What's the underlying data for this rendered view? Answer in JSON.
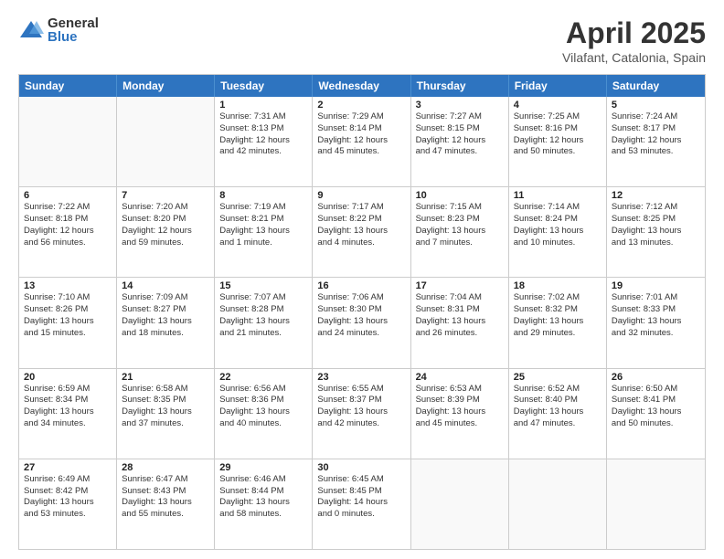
{
  "header": {
    "logo_general": "General",
    "logo_blue": "Blue",
    "title": "April 2025",
    "subtitle": "Vilafant, Catalonia, Spain"
  },
  "days_of_week": [
    "Sunday",
    "Monday",
    "Tuesday",
    "Wednesday",
    "Thursday",
    "Friday",
    "Saturday"
  ],
  "weeks": [
    [
      {
        "day": "",
        "lines": [],
        "empty": true
      },
      {
        "day": "",
        "lines": [],
        "empty": true
      },
      {
        "day": "1",
        "lines": [
          "Sunrise: 7:31 AM",
          "Sunset: 8:13 PM",
          "Daylight: 12 hours",
          "and 42 minutes."
        ]
      },
      {
        "day": "2",
        "lines": [
          "Sunrise: 7:29 AM",
          "Sunset: 8:14 PM",
          "Daylight: 12 hours",
          "and 45 minutes."
        ]
      },
      {
        "day": "3",
        "lines": [
          "Sunrise: 7:27 AM",
          "Sunset: 8:15 PM",
          "Daylight: 12 hours",
          "and 47 minutes."
        ]
      },
      {
        "day": "4",
        "lines": [
          "Sunrise: 7:25 AM",
          "Sunset: 8:16 PM",
          "Daylight: 12 hours",
          "and 50 minutes."
        ]
      },
      {
        "day": "5",
        "lines": [
          "Sunrise: 7:24 AM",
          "Sunset: 8:17 PM",
          "Daylight: 12 hours",
          "and 53 minutes."
        ]
      }
    ],
    [
      {
        "day": "6",
        "lines": [
          "Sunrise: 7:22 AM",
          "Sunset: 8:18 PM",
          "Daylight: 12 hours",
          "and 56 minutes."
        ]
      },
      {
        "day": "7",
        "lines": [
          "Sunrise: 7:20 AM",
          "Sunset: 8:20 PM",
          "Daylight: 12 hours",
          "and 59 minutes."
        ]
      },
      {
        "day": "8",
        "lines": [
          "Sunrise: 7:19 AM",
          "Sunset: 8:21 PM",
          "Daylight: 13 hours",
          "and 1 minute."
        ]
      },
      {
        "day": "9",
        "lines": [
          "Sunrise: 7:17 AM",
          "Sunset: 8:22 PM",
          "Daylight: 13 hours",
          "and 4 minutes."
        ]
      },
      {
        "day": "10",
        "lines": [
          "Sunrise: 7:15 AM",
          "Sunset: 8:23 PM",
          "Daylight: 13 hours",
          "and 7 minutes."
        ]
      },
      {
        "day": "11",
        "lines": [
          "Sunrise: 7:14 AM",
          "Sunset: 8:24 PM",
          "Daylight: 13 hours",
          "and 10 minutes."
        ]
      },
      {
        "day": "12",
        "lines": [
          "Sunrise: 7:12 AM",
          "Sunset: 8:25 PM",
          "Daylight: 13 hours",
          "and 13 minutes."
        ]
      }
    ],
    [
      {
        "day": "13",
        "lines": [
          "Sunrise: 7:10 AM",
          "Sunset: 8:26 PM",
          "Daylight: 13 hours",
          "and 15 minutes."
        ]
      },
      {
        "day": "14",
        "lines": [
          "Sunrise: 7:09 AM",
          "Sunset: 8:27 PM",
          "Daylight: 13 hours",
          "and 18 minutes."
        ]
      },
      {
        "day": "15",
        "lines": [
          "Sunrise: 7:07 AM",
          "Sunset: 8:28 PM",
          "Daylight: 13 hours",
          "and 21 minutes."
        ]
      },
      {
        "day": "16",
        "lines": [
          "Sunrise: 7:06 AM",
          "Sunset: 8:30 PM",
          "Daylight: 13 hours",
          "and 24 minutes."
        ]
      },
      {
        "day": "17",
        "lines": [
          "Sunrise: 7:04 AM",
          "Sunset: 8:31 PM",
          "Daylight: 13 hours",
          "and 26 minutes."
        ]
      },
      {
        "day": "18",
        "lines": [
          "Sunrise: 7:02 AM",
          "Sunset: 8:32 PM",
          "Daylight: 13 hours",
          "and 29 minutes."
        ]
      },
      {
        "day": "19",
        "lines": [
          "Sunrise: 7:01 AM",
          "Sunset: 8:33 PM",
          "Daylight: 13 hours",
          "and 32 minutes."
        ]
      }
    ],
    [
      {
        "day": "20",
        "lines": [
          "Sunrise: 6:59 AM",
          "Sunset: 8:34 PM",
          "Daylight: 13 hours",
          "and 34 minutes."
        ]
      },
      {
        "day": "21",
        "lines": [
          "Sunrise: 6:58 AM",
          "Sunset: 8:35 PM",
          "Daylight: 13 hours",
          "and 37 minutes."
        ]
      },
      {
        "day": "22",
        "lines": [
          "Sunrise: 6:56 AM",
          "Sunset: 8:36 PM",
          "Daylight: 13 hours",
          "and 40 minutes."
        ]
      },
      {
        "day": "23",
        "lines": [
          "Sunrise: 6:55 AM",
          "Sunset: 8:37 PM",
          "Daylight: 13 hours",
          "and 42 minutes."
        ]
      },
      {
        "day": "24",
        "lines": [
          "Sunrise: 6:53 AM",
          "Sunset: 8:39 PM",
          "Daylight: 13 hours",
          "and 45 minutes."
        ]
      },
      {
        "day": "25",
        "lines": [
          "Sunrise: 6:52 AM",
          "Sunset: 8:40 PM",
          "Daylight: 13 hours",
          "and 47 minutes."
        ]
      },
      {
        "day": "26",
        "lines": [
          "Sunrise: 6:50 AM",
          "Sunset: 8:41 PM",
          "Daylight: 13 hours",
          "and 50 minutes."
        ]
      }
    ],
    [
      {
        "day": "27",
        "lines": [
          "Sunrise: 6:49 AM",
          "Sunset: 8:42 PM",
          "Daylight: 13 hours",
          "and 53 minutes."
        ]
      },
      {
        "day": "28",
        "lines": [
          "Sunrise: 6:47 AM",
          "Sunset: 8:43 PM",
          "Daylight: 13 hours",
          "and 55 minutes."
        ]
      },
      {
        "day": "29",
        "lines": [
          "Sunrise: 6:46 AM",
          "Sunset: 8:44 PM",
          "Daylight: 13 hours",
          "and 58 minutes."
        ]
      },
      {
        "day": "30",
        "lines": [
          "Sunrise: 6:45 AM",
          "Sunset: 8:45 PM",
          "Daylight: 14 hours",
          "and 0 minutes."
        ]
      },
      {
        "day": "",
        "lines": [],
        "empty": true
      },
      {
        "day": "",
        "lines": [],
        "empty": true
      },
      {
        "day": "",
        "lines": [],
        "empty": true
      }
    ]
  ]
}
